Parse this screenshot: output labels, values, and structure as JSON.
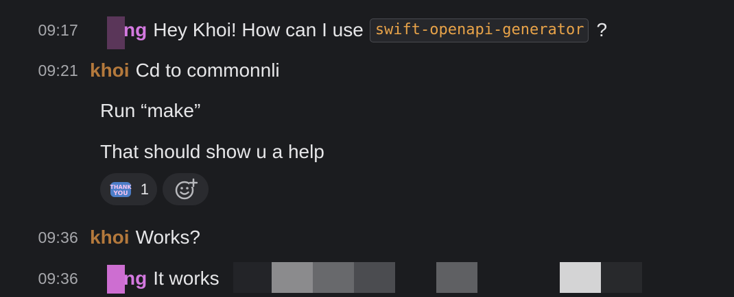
{
  "messages": [
    {
      "time": "09:17",
      "user": "ng",
      "text": "Hey Khoi! How can I use",
      "code": "swift-openapi-generator",
      "suffix": "?"
    },
    {
      "time": "09:21",
      "user": "khoi",
      "text": "Cd to commonnli"
    },
    {
      "text": "Run “make”"
    },
    {
      "text": "That should show u a help"
    },
    {
      "time": "09:36",
      "user": "khoi",
      "text": "Works?"
    },
    {
      "time": "09:36",
      "user": "ng",
      "text": "It works"
    }
  ],
  "reactions": {
    "thank_you": {
      "emoji_lines": [
        "THANK",
        "YOU"
      ],
      "count": "1"
    },
    "add_reaction_icon": "add-reaction-icon"
  },
  "colors": {
    "background": "#1b1c1f",
    "timestamp": "#a7a8ac",
    "message_text": "#e6e6e8",
    "username_khoi": "#b4793c",
    "username_purple": "#d479e0",
    "code_text": "#e8a349",
    "code_border": "#4a4b50",
    "pill_background": "#2a2b2f"
  }
}
